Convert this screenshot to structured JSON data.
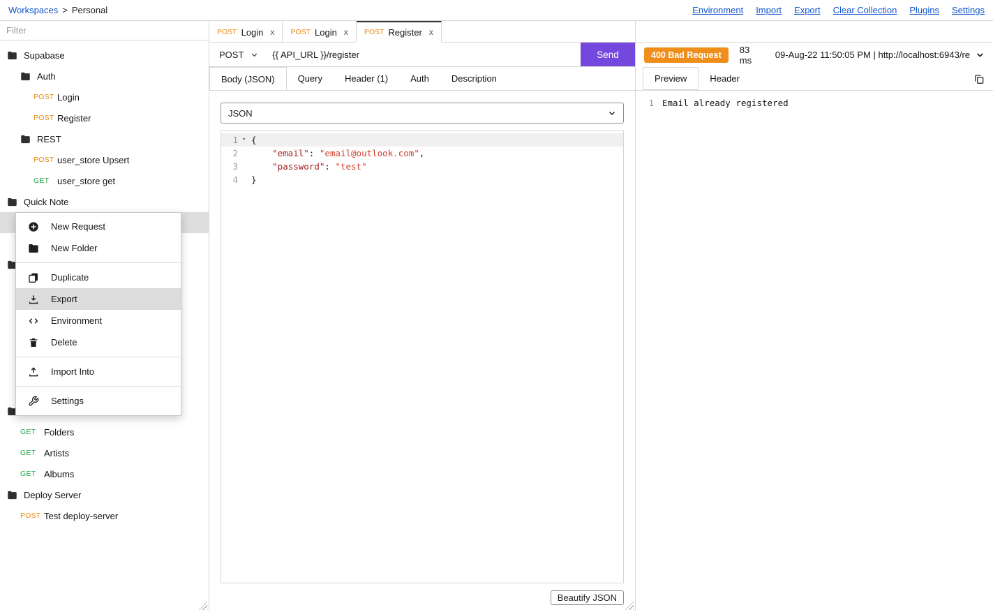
{
  "colors": {
    "accent_send_button": "#7448dd",
    "method_post": "#eb8a10",
    "method_get": "#2aa84a",
    "status_400_badge_bg": "#ef8e1b",
    "link_blue": "#1155cc",
    "menu_highlight": "#dcdcdc"
  },
  "topbar": {
    "breadcrumb": {
      "workspaces": "Workspaces",
      "separator": ">",
      "workspace_name": "Personal"
    },
    "links": {
      "environment": "Environment",
      "import": "Import",
      "export": "Export",
      "clear_collection": "Clear Collection",
      "plugins": "Plugins",
      "settings": "Settings"
    }
  },
  "sidebar": {
    "filter_placeholder": "Filter",
    "items": [
      {
        "type": "folder",
        "label": "Supabase",
        "indent": 0
      },
      {
        "type": "folder",
        "label": "Auth",
        "indent": 1
      },
      {
        "type": "request",
        "method": "POST",
        "label": "Login",
        "indent": 2
      },
      {
        "type": "request",
        "method": "POST",
        "label": "Register",
        "indent": 2
      },
      {
        "type": "folder",
        "label": "REST",
        "indent": 1
      },
      {
        "type": "request",
        "method": "POST",
        "label": "user_store Upsert",
        "indent": 2
      },
      {
        "type": "request",
        "method": "GET",
        "label": "user_store get",
        "indent": 2
      },
      {
        "type": "folder",
        "label": "Quick Note",
        "indent": 0
      },
      {
        "type": "selected",
        "label": "",
        "indent": 0
      },
      {
        "type": "spacer"
      },
      {
        "type": "folder",
        "label": "",
        "indent": 0
      },
      {
        "type": "spacer"
      },
      {
        "type": "spacer"
      },
      {
        "type": "spacer"
      },
      {
        "type": "spacer"
      },
      {
        "type": "spacer"
      },
      {
        "type": "spacer"
      },
      {
        "type": "folder",
        "label": "",
        "indent": 0
      },
      {
        "type": "request",
        "method": "GET",
        "label": "Folders",
        "indent": 1
      },
      {
        "type": "request",
        "method": "GET",
        "label": "Artists",
        "indent": 1
      },
      {
        "type": "request",
        "method": "GET",
        "label": "Albums",
        "indent": 1
      },
      {
        "type": "folder",
        "label": "Deploy Server",
        "indent": 0
      },
      {
        "type": "request",
        "method": "POST",
        "label": "Test deploy-server",
        "indent": 1
      }
    ]
  },
  "context_menu": {
    "new_request": "New Request",
    "new_folder": "New Folder",
    "duplicate": "Duplicate",
    "export": "Export",
    "environment": "Environment",
    "delete": "Delete",
    "import_into": "Import Into",
    "settings": "Settings"
  },
  "request": {
    "tabs": [
      {
        "method": "POST",
        "label": "Login",
        "close": "x"
      },
      {
        "method": "POST",
        "label": "Login",
        "close": "x"
      },
      {
        "method": "POST",
        "label": "Register",
        "close": "x"
      }
    ],
    "method": "POST",
    "url": "{{ API_URL }}/register",
    "send": "Send",
    "section_tabs": {
      "body": "Body (JSON)",
      "query": "Query",
      "header": "Header (1)",
      "auth": "Auth",
      "description": "Description"
    },
    "body_type": "JSON",
    "editor": {
      "fold_icon": "▾",
      "line1": {
        "num": "1",
        "text": "{"
      },
      "line2": {
        "num": "2",
        "indent": "    ",
        "key": "\"email\"",
        "sep": ": ",
        "value": "\"email@outlook.com\"",
        "tail": ","
      },
      "line3": {
        "num": "3",
        "indent": "    ",
        "key": "\"password\"",
        "sep": ": ",
        "value": "\"test\"",
        "tail": ""
      },
      "line4": {
        "num": "4",
        "text": "}"
      }
    },
    "beautify": "Beautify JSON"
  },
  "response": {
    "status": "400 Bad Request",
    "time": "83 ms",
    "meta": "09-Aug-22 11:50:05 PM | http://localhost:6943/re",
    "tabs": {
      "preview": "Preview",
      "header": "Header"
    },
    "line_num": "1",
    "body": "Email already registered"
  }
}
